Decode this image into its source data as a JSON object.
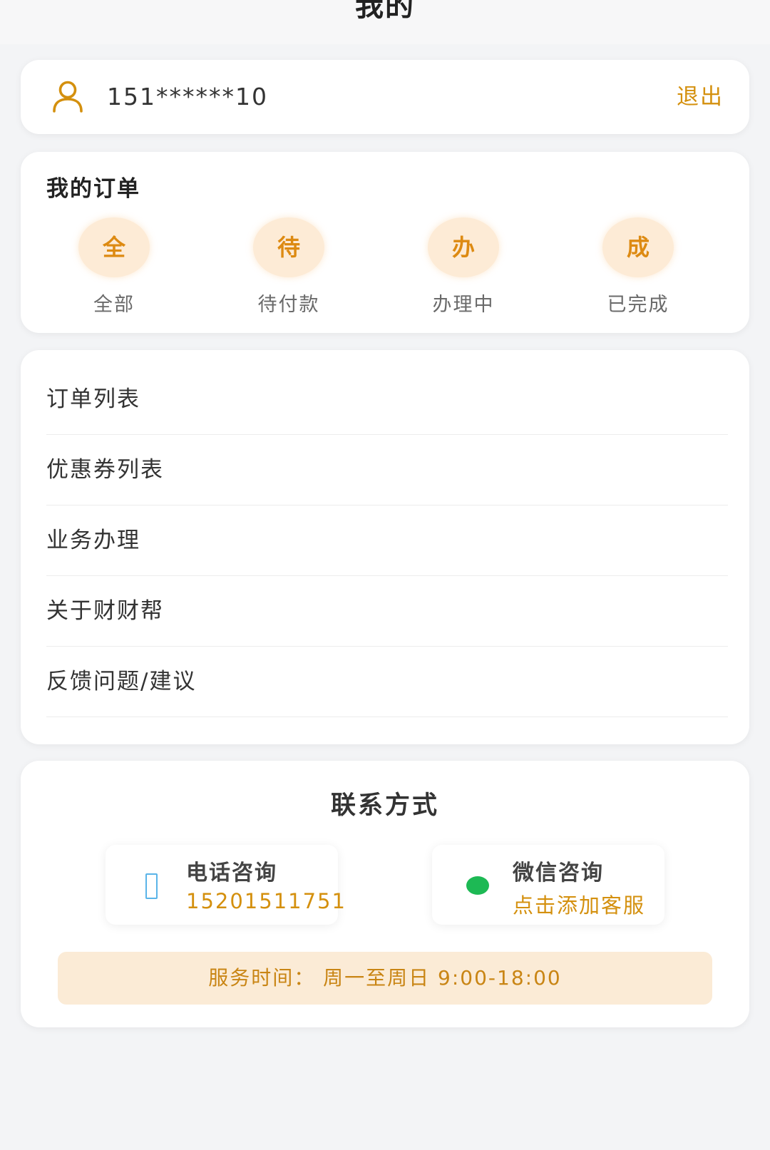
{
  "header": {
    "title": "我的"
  },
  "user": {
    "phone": "151******10",
    "logout_label": "退出",
    "icon": "user-icon"
  },
  "orders": {
    "title": "我的订单",
    "items": [
      {
        "badge": "全",
        "label": "全部"
      },
      {
        "badge": "待",
        "label": "待付款"
      },
      {
        "badge": "办",
        "label": "办理中"
      },
      {
        "badge": "成",
        "label": "已完成"
      }
    ]
  },
  "menu": {
    "items": [
      {
        "label": "订单列表"
      },
      {
        "label": "优惠券列表"
      },
      {
        "label": "业务办理"
      },
      {
        "label": "关于财财帮"
      },
      {
        "label": "反馈问题/建议"
      }
    ]
  },
  "contact": {
    "title": "联系方式",
    "phone": {
      "title": "电话咨询",
      "number": "15201511751",
      "icon": "phone-icon"
    },
    "wechat": {
      "title": "微信咨询",
      "action": "点击添加客服",
      "icon": "wechat-icon"
    },
    "service_time": "服务时间： 周一至周日 9:00-18:00"
  },
  "colors": {
    "accent": "#d4900e",
    "badge_bg": "#fdebd6",
    "wechat_green": "#1db954",
    "phone_blue": "#5ab4e8"
  }
}
